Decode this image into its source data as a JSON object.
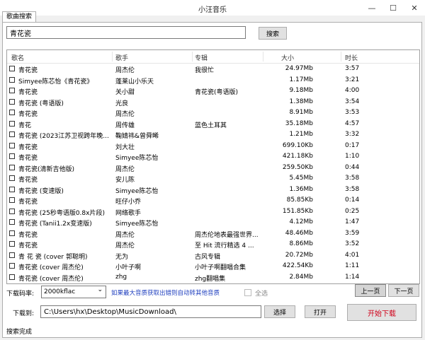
{
  "window": {
    "title": "小汪音乐",
    "minimize": "—",
    "maximize": "☐",
    "close": "✕"
  },
  "tab": {
    "label": "歌曲搜索"
  },
  "search": {
    "value": "青花瓷",
    "button": "搜索"
  },
  "columns": [
    "歌名",
    "歌手",
    "专辑",
    "大小",
    "时长"
  ],
  "songs": [
    {
      "name": "青花瓷",
      "artist": "周杰伦",
      "album": "我很忙",
      "size": "24.97Mb",
      "duration": "3:57"
    },
    {
      "name": "Simyee陈芯怡《青花瓷》",
      "artist": "蓬莱山小乐天",
      "album": "",
      "size": "1.17Mb",
      "duration": "3:21"
    },
    {
      "name": "青花瓷",
      "artist": "关小甜",
      "album": "青花瓷(粤语版)",
      "size": "9.18Mb",
      "duration": "4:00"
    },
    {
      "name": "青花瓷 (粤语版)",
      "artist": "光良",
      "album": "",
      "size": "1.38Mb",
      "duration": "3:54"
    },
    {
      "name": "青花瓷",
      "artist": "周杰伦",
      "album": "",
      "size": "8.91Mb",
      "duration": "3:53"
    },
    {
      "name": "青花",
      "artist": "周传雄",
      "album": "蓝色土耳其",
      "size": "35.18Mb",
      "duration": "4:57"
    },
    {
      "name": "青花瓷 (2023江苏卫视跨年晚...",
      "artist": "鞠婧祎&曾舜晞",
      "album": "",
      "size": "1.21Mb",
      "duration": "3:32"
    },
    {
      "name": "青花瓷",
      "artist": "刘大壮",
      "album": "",
      "size": "699.10Kb",
      "duration": "0:17"
    },
    {
      "name": "青花瓷",
      "artist": "Simyee陈芯怡",
      "album": "",
      "size": "421.18Kb",
      "duration": "1:10"
    },
    {
      "name": "青花瓷(清新吉他版)",
      "artist": "周杰伦",
      "album": "",
      "size": "259.50Kb",
      "duration": "0:44"
    },
    {
      "name": "青花瓷",
      "artist": "安儿陈",
      "album": "",
      "size": "5.45Mb",
      "duration": "3:58"
    },
    {
      "name": "青花瓷 (变速版)",
      "artist": "Simyee陈芯怡",
      "album": "",
      "size": "1.36Mb",
      "duration": "3:58"
    },
    {
      "name": "青花瓷",
      "artist": "旺仔小乔",
      "album": "",
      "size": "85.85Kb",
      "duration": "0:14"
    },
    {
      "name": "青花瓷 (25秒粤语版0.8x片段)",
      "artist": "网络歌手",
      "album": "",
      "size": "151.85Kb",
      "duration": "0:25"
    },
    {
      "name": "青花瓷 (Tanii1.2x变速版)",
      "artist": "Simyee陈芯怡",
      "album": "",
      "size": "4.12Mb",
      "duration": "1:47"
    },
    {
      "name": "青花瓷",
      "artist": "周杰伦",
      "album": "周杰伦地表最强世界...",
      "size": "48.46Mb",
      "duration": "3:59"
    },
    {
      "name": "青花瓷",
      "artist": "周杰伦",
      "album": "至 Hit 流行精选 4 ...",
      "size": "8.86Mb",
      "duration": "3:52"
    },
    {
      "name": "青 花 瓷 (cover 郭聪明)",
      "artist": "无为",
      "album": "古风专辑",
      "size": "20.72Mb",
      "duration": "4:01"
    },
    {
      "name": "青花瓷 (cover 周杰伦)",
      "artist": "小叶子啊",
      "album": "小叶子啊翻唱合集",
      "size": "422.54Kb",
      "duration": "1:11"
    },
    {
      "name": "青花瓷 (cover 周杰伦)",
      "artist": "zhg",
      "album": "zhg翻唱集",
      "size": "2.84Mb",
      "duration": "1:14"
    }
  ],
  "controls": {
    "bitrate_label": "下载码率:",
    "bitrate_value": "2000kflac",
    "dropdown_arrow": "⌄",
    "hint": "如果最大音质获取出错则自动转其他音质",
    "select_all": "全选",
    "prev_page": "上一页",
    "next_page": "下一页",
    "download_to_label": "下载到:",
    "download_path": "C:\\Users\\hx\\Desktop\\MusicDownload\\",
    "choose_button": "选择",
    "open_button": "打开",
    "start_download": "开始下载",
    "accent_color": "#d0021b"
  },
  "status": {
    "text": "搜索完成"
  }
}
